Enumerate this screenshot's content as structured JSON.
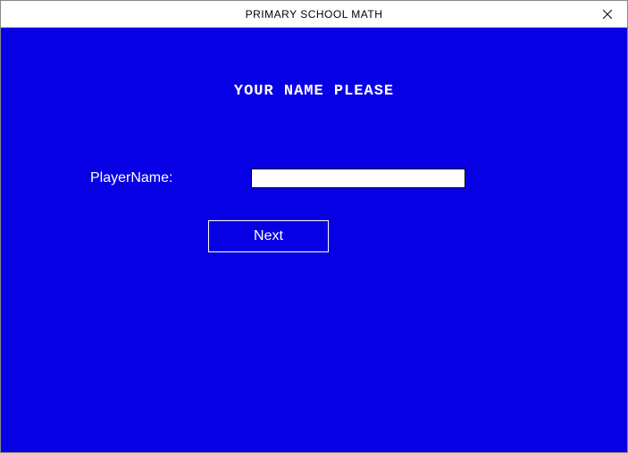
{
  "window": {
    "title": "PRIMARY SCHOOL MATH"
  },
  "form": {
    "heading": "YOUR NAME PLEASE",
    "player_name_label": "PlayerName:",
    "player_name_value": "",
    "next_button_label": "Next"
  }
}
